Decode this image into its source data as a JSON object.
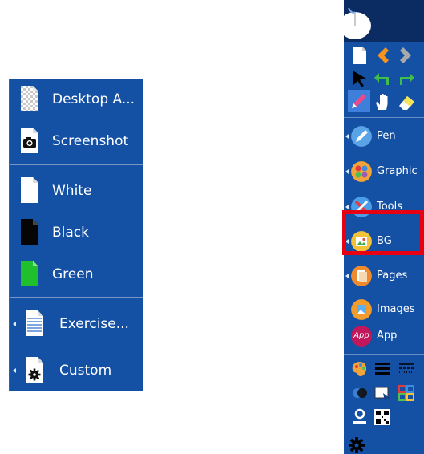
{
  "background_menu": {
    "items": [
      {
        "label": "Desktop A...",
        "icon": "transparent-page-icon"
      },
      {
        "label": "Screenshot",
        "icon": "camera-icon"
      },
      {
        "label": "White",
        "icon": "white-page-icon"
      },
      {
        "label": "Black",
        "icon": "black-page-icon"
      },
      {
        "label": "Green",
        "icon": "green-page-icon"
      },
      {
        "label": "Exercise...",
        "icon": "lined-page-icon",
        "has_submenu": true
      },
      {
        "label": "Custom",
        "icon": "gear-page-icon",
        "has_submenu": true
      }
    ]
  },
  "toolbar": {
    "items": [
      {
        "label": "Pen",
        "icon": "pen-icon",
        "has_submenu": true
      },
      {
        "label": "Graphic",
        "icon": "palette-icon",
        "has_submenu": true
      },
      {
        "label": "Tools",
        "icon": "tools-icon",
        "has_submenu": true
      },
      {
        "label": "BG",
        "icon": "image-icon",
        "has_submenu": true,
        "highlighted": true
      },
      {
        "label": "Pages",
        "icon": "pages-icon",
        "has_submenu": true
      },
      {
        "label": "Images",
        "icon": "images-icon",
        "has_submenu": false
      },
      {
        "label": "App",
        "icon": "app-icon",
        "has_submenu": false
      }
    ],
    "app_badge": "App"
  },
  "colors": {
    "menu_bg": "#1450a3",
    "toolbar_dark": "#0b2b63",
    "highlight": "#e60012",
    "green_page": "#1fbf2e"
  }
}
